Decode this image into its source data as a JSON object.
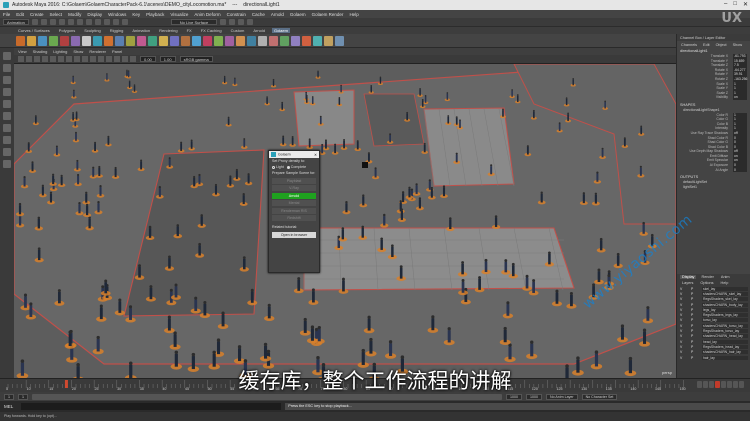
{
  "window": {
    "title": "Autodesk Maya 2016: C:\\Golaem\\GolaemCharacterPack-6.1\\scenes\\DEMO_cityLocomotion.ma*",
    "separator": "---",
    "node": "directionalLight1",
    "controls": [
      "–",
      "□",
      "✕"
    ]
  },
  "menubar": [
    "File",
    "Edit",
    "Create",
    "Select",
    "Modify",
    "Display",
    "Windows",
    "Key",
    "Playback",
    "Visualize",
    "Anim Deform",
    "Constrain",
    "Cache",
    "Arnold",
    "Golaem",
    "Golaem Render",
    "Help"
  ],
  "status": {
    "mode": "Animation",
    "field": "No Live Surface"
  },
  "shelf_tabs": [
    "Curves / Surfaces",
    "Polygons",
    "Sculpting",
    "Rigging",
    "Animation",
    "Rendering",
    "FX",
    "FX Caching",
    "Custom",
    "Arnold",
    "Golaem"
  ],
  "shelf_active": "Golaem",
  "viewport": {
    "menu": [
      "View",
      "Shading",
      "Lighting",
      "Show",
      "Renderer",
      "Panel"
    ],
    "gamma": "sRGB gamma",
    "camera_label": "persp"
  },
  "dialog": {
    "title": "Golaem",
    "close": "✕",
    "intro": "Set Proxy density to:",
    "radio_light": "Light",
    "radio_complete": "Complete",
    "prepare": "Prepare Sample Scene for:",
    "buttons": [
      "Playblast",
      "V-Ray",
      "Arnold",
      "Mental",
      "Renderman RIS",
      "Redshift"
    ],
    "active_button": "Arnold",
    "related": "Related tutorial:",
    "open_browser": "Open in browser"
  },
  "right_panel": {
    "tabs": [
      "Channel Box / Layer Editor"
    ],
    "menu": [
      "Channels",
      "Edit",
      "Object",
      "Show"
    ],
    "node": "directionalLight1",
    "attrs": [
      {
        "k": "Translate X",
        "v": "-61.793"
      },
      {
        "k": "Translate Y",
        "v": "15.659"
      },
      {
        "k": "Translate Z",
        "v": "7.5"
      },
      {
        "k": "Rotate X",
        "v": "-64.277"
      },
      {
        "k": "Rotate Y",
        "v": "39.91"
      },
      {
        "k": "Rotate Z",
        "v": "-163.256"
      },
      {
        "k": "Scale X",
        "v": "1"
      },
      {
        "k": "Scale Y",
        "v": "1"
      },
      {
        "k": "Scale Z",
        "v": "1"
      },
      {
        "k": "Visibility",
        "v": "on"
      }
    ],
    "shapes_head": "SHAPES",
    "shape_node": "directionalLightShape1",
    "shape_attrs": [
      {
        "k": "Color R",
        "v": "1"
      },
      {
        "k": "Color G",
        "v": "1"
      },
      {
        "k": "Color B",
        "v": "1"
      },
      {
        "k": "Intensity",
        "v": "1"
      },
      {
        "k": "Use Ray Trace Shadows",
        "v": "off"
      },
      {
        "k": "Shad Color R",
        "v": "0"
      },
      {
        "k": "Shad Color G",
        "v": "0"
      },
      {
        "k": "Shad Color B",
        "v": "0"
      },
      {
        "k": "Use Depth Map Shadows",
        "v": "off"
      },
      {
        "k": "Emit Diffuse",
        "v": "on"
      },
      {
        "k": "Emit Specular",
        "v": "on"
      },
      {
        "k": "Ai Exposure",
        "v": "0"
      },
      {
        "k": "Ai Angle",
        "v": "0"
      }
    ],
    "outputs_head": "OUTPUTS",
    "outputs": [
      "defaultLightSet",
      "lightSet1"
    ],
    "lower_tabs": [
      "Display",
      "Render",
      "Anim"
    ],
    "lower_active": "Display",
    "lower_menu": [
      "Layers",
      "Options",
      "Help"
    ],
    "layers": [
      "skel_lay",
      "shadersCHARN_skel_lay",
      "RegsShaders_skel_lay",
      "shadersCHARN_body_lay",
      "legs_lay",
      "RegsShaders_legs_lay",
      "torso_lay",
      "shadersCHARN_torso_lay",
      "RegsShaders_torso_lay",
      "shadersCHARN_head_lay",
      "head_lay",
      "RegsShaders_head_lay",
      "shadersCHARN_hair_lay",
      "hair_lay"
    ]
  },
  "timeline": {
    "ticks": [
      "5",
      "10",
      "15",
      "20",
      "25",
      "30",
      "35",
      "40",
      "45",
      "50",
      "55",
      "60",
      "65",
      "70",
      "75",
      "80",
      "85",
      "90",
      "95",
      "100",
      "105",
      "110",
      "115",
      "120",
      "125",
      "130",
      "135",
      "140",
      "145",
      "150"
    ],
    "current": "14"
  },
  "range": {
    "start": "1",
    "start2": "1",
    "end": "1000",
    "end2": "1000",
    "anim_layer": "No Anim Layer",
    "char_set": "No Character Set"
  },
  "cmd": {
    "label": "MEL",
    "result": "Press the ESC key to stop playback..."
  },
  "help": "Play forwards. Hold key to (opt)...",
  "subtitle": "缓存库，整个工作流程的讲解",
  "watermark": "www.yiyaoshi.com",
  "corner_logo": "UX"
}
